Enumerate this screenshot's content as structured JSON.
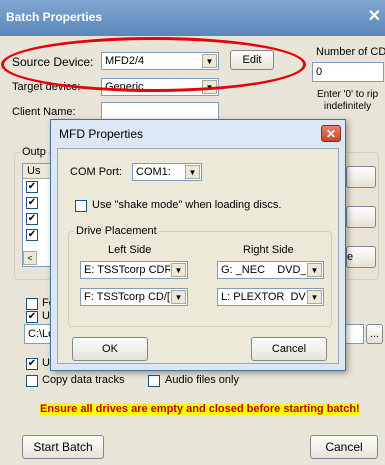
{
  "main": {
    "title": "Batch Properties",
    "close_glyph": "✕",
    "source_device_label": "Source Device:",
    "source_device_value": "MFD2/4",
    "edit_label": "Edit",
    "number_of_cds_label": "Number of CDs",
    "number_of_cds_value": "0",
    "target_device_label": "Target device:",
    "target_device_value": "Generic",
    "rip_hint": "Enter '0' to rip indefinitely",
    "client_name_label": "Client Name:",
    "client_name_value": "",
    "output_group_partial": "Outp",
    "list_header_partial": "Us",
    "scroll_left_glyph": "<",
    "right_button_partial": "e",
    "fo_partial": "Fo",
    "us_partial_1": "Us",
    "path_partial": "C:\\Lo",
    "browse_label": "...",
    "us_partial_2": "Us",
    "copy_data_tracks_label": "Copy data tracks",
    "audio_files_only_label": "Audio files only",
    "warning": "Ensure all drives are empty and closed before starting batch!",
    "start_batch_label": "Start Batch",
    "cancel_label": "Cancel"
  },
  "modal": {
    "title": "MFD Properties",
    "com_port_label": "COM Port:",
    "com_port_value": "COM1:",
    "shake_mode_label": "Use \"shake mode\" when loading discs.",
    "drive_placement_label": "Drive Placement",
    "left_side_label": "Left Side",
    "right_side_label": "Right Side",
    "left_drives": [
      "E: TSSTcorp CDR",
      "F: TSSTcorp CD/["
    ],
    "right_drives": [
      "G: _NEC    DVD_",
      "L: PLEXTOR  DVD"
    ],
    "ok_label": "OK",
    "cancel_label": "Cancel"
  },
  "colors": {
    "title_bar": "#5a88bb",
    "highlight_oval": "#e8000b",
    "warning_text": "#c00000",
    "warning_bg": "#ffff00"
  }
}
